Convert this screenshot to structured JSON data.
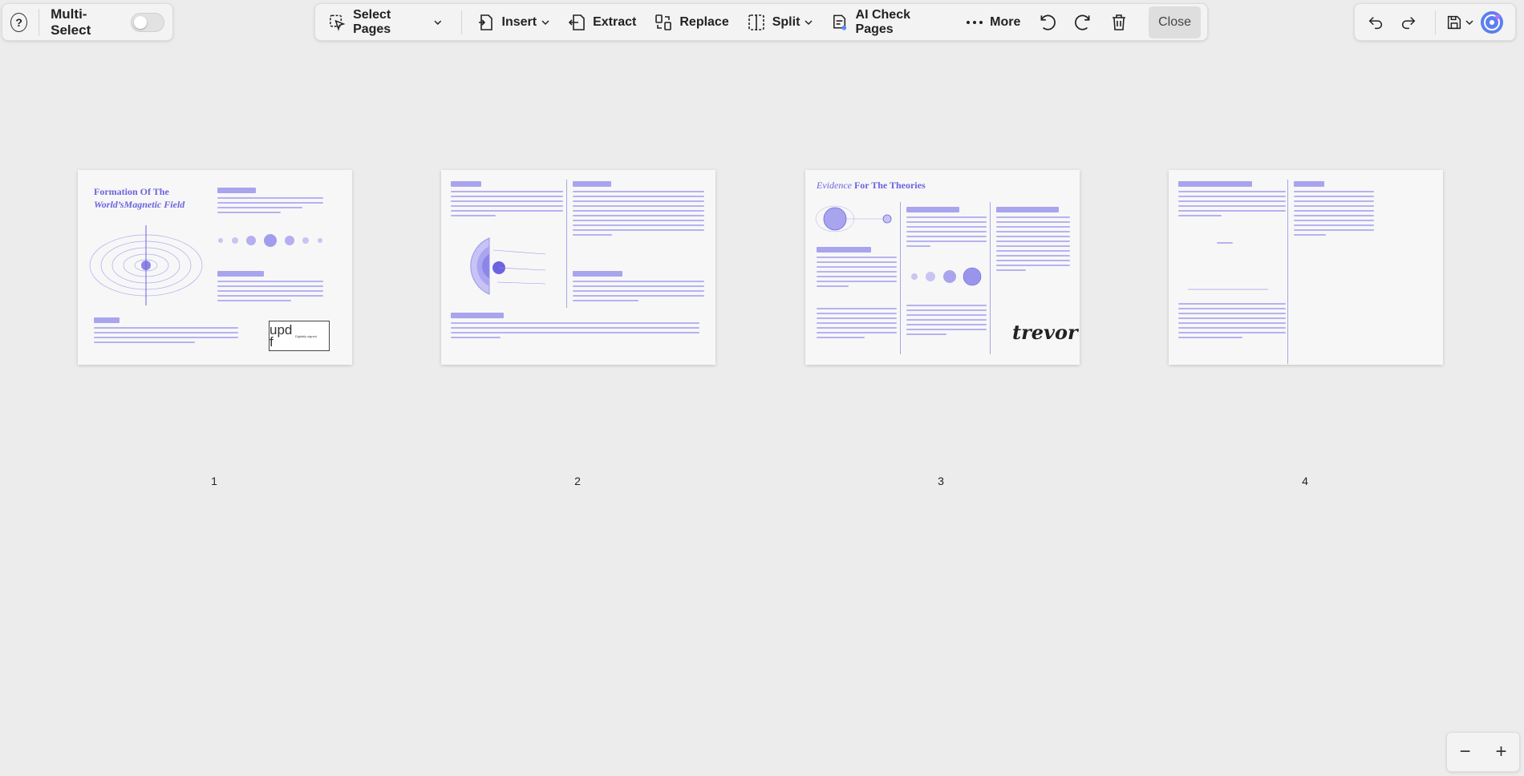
{
  "left_bar": {
    "help_icon": "question-circle-icon",
    "multi_select_label": "Multi-Select",
    "multi_select_on": false
  },
  "toolbar": {
    "select_pages": "Select Pages",
    "insert": "Insert",
    "extract": "Extract",
    "replace": "Replace",
    "split": "Split",
    "ai_check": "AI Check Pages",
    "more": "More",
    "close": "Close"
  },
  "right_bar": {
    "icons": [
      "undo-icon",
      "redo-icon",
      "save-icon",
      "chevron-down-icon",
      "ai-assistant-icon"
    ]
  },
  "pages": [
    {
      "number": "1",
      "title_line1": "Formation Of The",
      "title_line2": "World’sMagnetic Field",
      "stamp_text": "upd f",
      "stamp_meta": "Digitally signed"
    },
    {
      "number": "2"
    },
    {
      "number": "3",
      "title_italic": "Evidence",
      "title_rest": "For The Theories",
      "signature": "trevor"
    },
    {
      "number": "4"
    }
  ],
  "zoom": {
    "out": "−",
    "in": "+"
  },
  "colors": {
    "accent": "#6b63e0",
    "page_text": "#b6b2f0",
    "background": "#ececec"
  }
}
